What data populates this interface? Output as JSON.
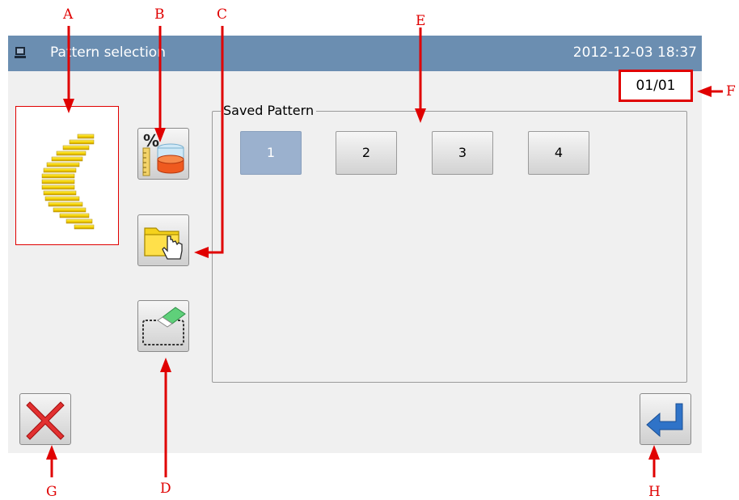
{
  "window": {
    "title": "Pattern selection",
    "datetime": "2012-12-03  18:37"
  },
  "page_counter": "01/01",
  "saved_group": {
    "label": "Saved Pattern"
  },
  "patterns": [
    {
      "label": "1",
      "selected": true
    },
    {
      "label": "2",
      "selected": false
    },
    {
      "label": "3",
      "selected": false
    },
    {
      "label": "4",
      "selected": false
    }
  ],
  "tools": {
    "scale_icon": "percent-scale-icon",
    "open_icon": "folder-hand-icon",
    "erase_icon": "eraser-icon"
  },
  "buttons": {
    "cancel_icon": "close-x-icon",
    "enter_icon": "return-arrow-icon"
  },
  "annotations": {
    "A": "A",
    "B": "B",
    "C": "C",
    "D": "D",
    "E": "E",
    "F": "F",
    "G": "G",
    "H": "H"
  },
  "colors": {
    "titlebar": "#6b8eb1",
    "selected": "#9bb1ce",
    "annotation": "#e00000"
  }
}
